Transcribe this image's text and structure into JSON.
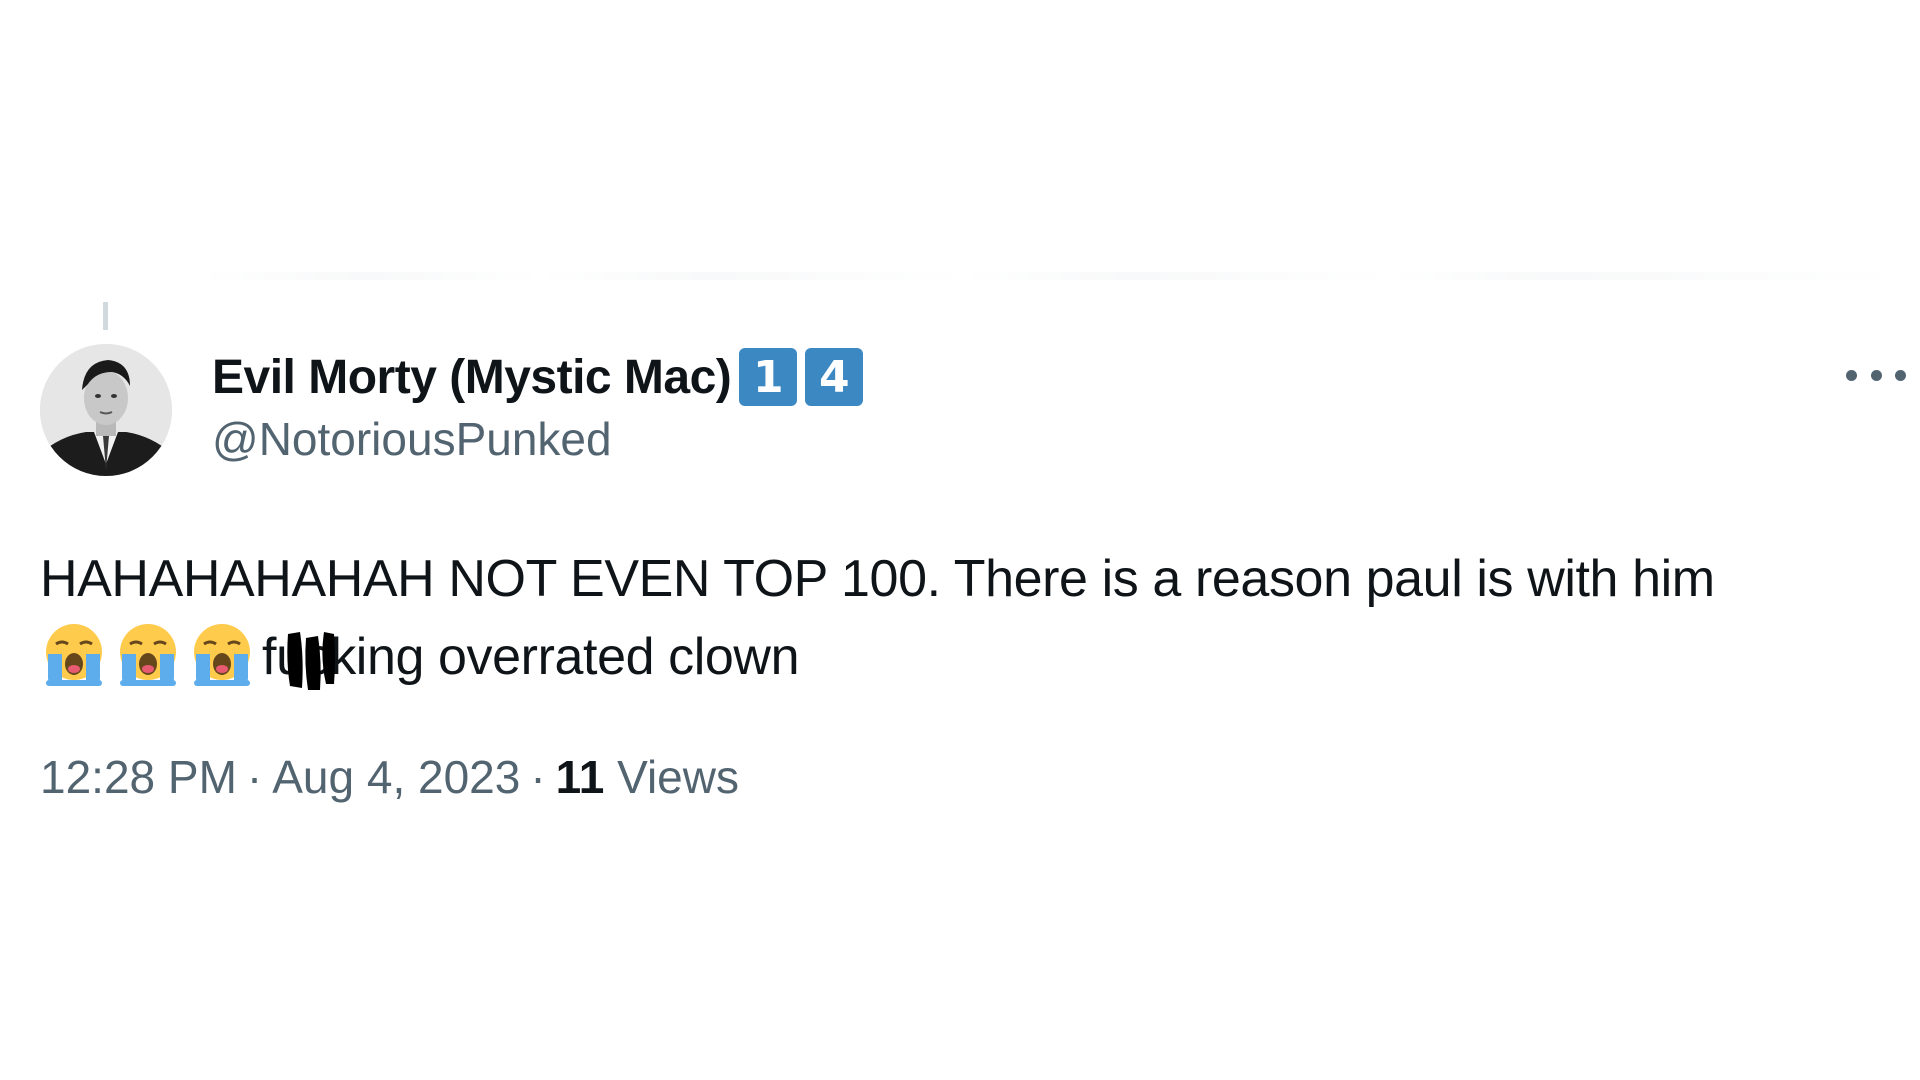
{
  "tweet": {
    "display_name": "Evil Morty (Mystic Mac)",
    "badges": [
      "1",
      "4"
    ],
    "handle": "@NotoriousPunked",
    "text_line1": "HAHAHAHAHAH NOT EVEN TOP 100. There is a reason paul is with him",
    "text_line2_prefix": "f",
    "text_line2_censored": "uc",
    "text_line2_suffix": "king overrated clown",
    "emoji_count": 3,
    "emoji_icon": "loudly-crying-face-icon",
    "time": "12:28 PM",
    "date": "Aug 4, 2023",
    "separator": "·",
    "views_count": "11",
    "views_label": "Views"
  },
  "colors": {
    "text_primary": "#0f1419",
    "text_secondary": "#536471",
    "badge_blue": "#3b88c3",
    "background": "#ffffff"
  }
}
